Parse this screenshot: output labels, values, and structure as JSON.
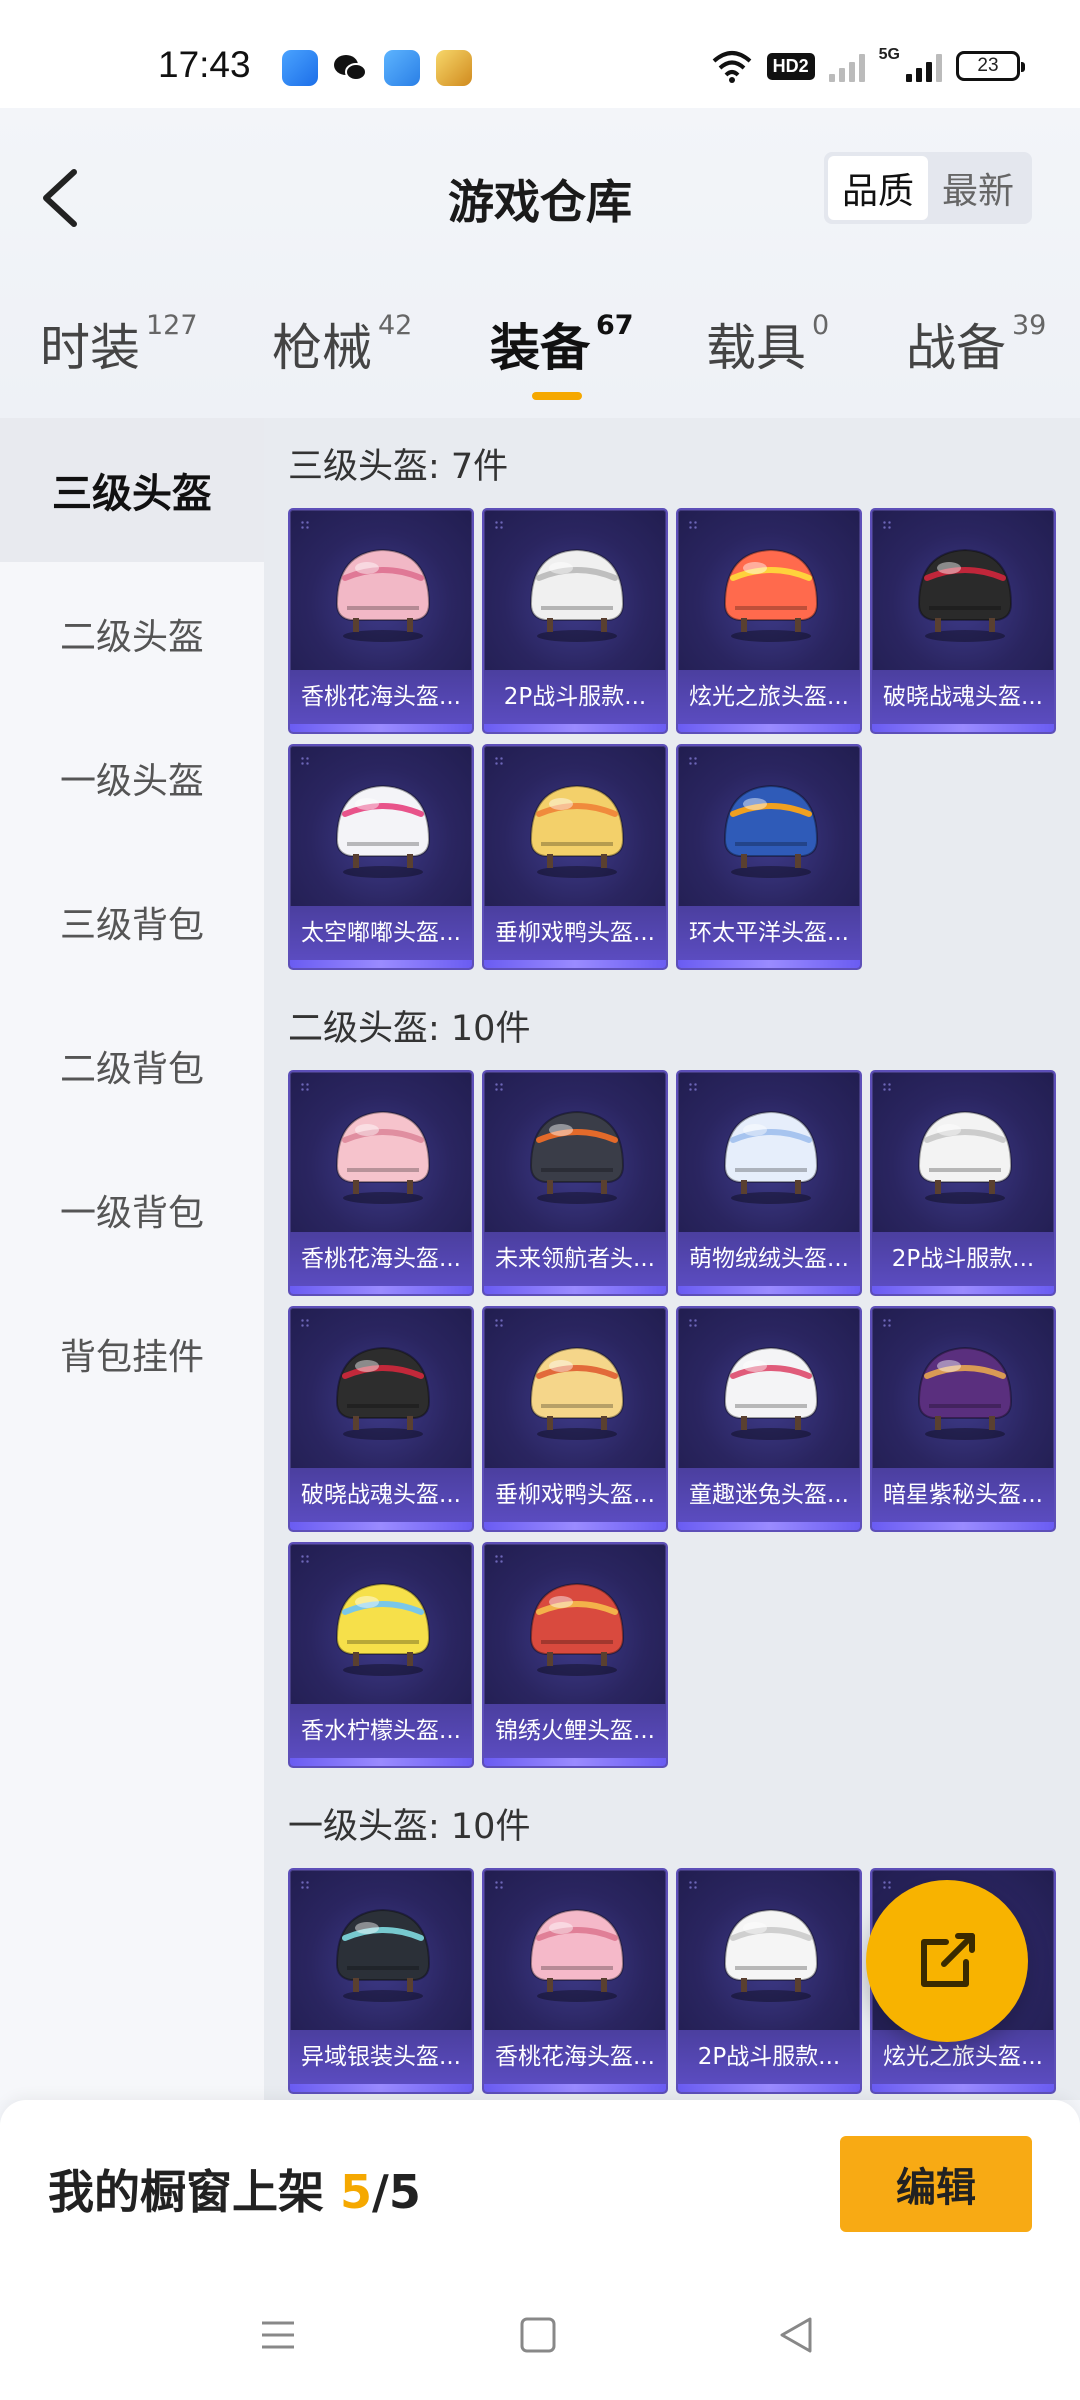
{
  "status_bar": {
    "time": "17:43",
    "network": "HD2",
    "network_type": "5G",
    "battery": "23",
    "icons": [
      "app-blue-icon",
      "wechat-icon",
      "app-cube-icon",
      "game-app-icon",
      "wifi-icon"
    ]
  },
  "header": {
    "title": "游戏仓库",
    "sort_options": [
      "品质",
      "最新"
    ],
    "active_sort": "品质"
  },
  "tabs": [
    {
      "label": "时装",
      "count": "127"
    },
    {
      "label": "枪械",
      "count": "42"
    },
    {
      "label": "装备",
      "count": "67"
    },
    {
      "label": "载具",
      "count": "0"
    },
    {
      "label": "战备",
      "count": "39"
    }
  ],
  "active_tab": "装备",
  "sidebar": {
    "items": [
      "三级头盔",
      "二级头盔",
      "一级头盔",
      "三级背包",
      "二级背包",
      "一级背包",
      "背包挂件"
    ],
    "active": "三级头盔"
  },
  "sections": [
    {
      "title": "三级头盔: 7件",
      "items": [
        {
          "name": "香桃花海头盔...",
          "color": "#f2b8c6",
          "accent": "#e07896"
        },
        {
          "name": "2P战斗服款...",
          "color": "#f0f0f0",
          "accent": "#bfbfbf"
        },
        {
          "name": "炫光之旅头盔...",
          "color": "#ff6a4d",
          "accent": "#ffd23c"
        },
        {
          "name": "破晓战魂头盔...",
          "color": "#2a2a2a",
          "accent": "#c0263a"
        },
        {
          "name": "太空嘟嘟头盔...",
          "color": "#f4f4f8",
          "accent": "#e8538a"
        },
        {
          "name": "垂柳戏鸭头盔...",
          "color": "#f3d06a",
          "accent": "#f08a3c"
        },
        {
          "name": "环太平洋头盔...",
          "color": "#2f5bb8",
          "accent": "#f0a020"
        }
      ]
    },
    {
      "title": "二级头盔: 10件",
      "items": [
        {
          "name": "香桃花海头盔...",
          "color": "#f6c3cc",
          "accent": "#e08ea0"
        },
        {
          "name": "未来领航者头...",
          "color": "#3a3d48",
          "accent": "#e36a2a"
        },
        {
          "name": "萌物绒绒头盔...",
          "color": "#e6eefb",
          "accent": "#a7c4ef"
        },
        {
          "name": "2P战斗服款...",
          "color": "#f3f3f3",
          "accent": "#cccccc"
        },
        {
          "name": "破晓战魂头盔...",
          "color": "#2d2d2d",
          "accent": "#c2283a"
        },
        {
          "name": "垂柳戏鸭头盔...",
          "color": "#f5d68a",
          "accent": "#e26a3a"
        },
        {
          "name": "童趣迷兔头盔...",
          "color": "#f4f4f6",
          "accent": "#e05b7a"
        },
        {
          "name": "暗星紫秘头盔...",
          "color": "#5a2f7e",
          "accent": "#d99a54"
        },
        {
          "name": "香水柠檬头盔...",
          "color": "#f6e04a",
          "accent": "#7ac7e8"
        },
        {
          "name": "锦绣火鲤头盔...",
          "color": "#d94a3e",
          "accent": "#f3b24a"
        }
      ]
    },
    {
      "title": "一级头盔: 10件",
      "items": [
        {
          "name": "异域银装头盔...",
          "color": "#2b3038",
          "accent": "#77c9cf"
        },
        {
          "name": "香桃花海头盔...",
          "color": "#f5b9c9",
          "accent": "#e07f97"
        },
        {
          "name": "2P战斗服款...",
          "color": "#f5f5f5",
          "accent": "#cfcfcf"
        },
        {
          "name": "炫光之旅头盔...",
          "color": "#ff7a52",
          "accent": "#ffd23c"
        }
      ]
    }
  ],
  "bottom_bar": {
    "showcase_label": "我的橱窗上架",
    "showcase_current": "5",
    "showcase_total": "5",
    "edit_label": "编辑"
  },
  "colors": {
    "accent": "#f5a800",
    "card_bg": "#2a2560",
    "card_label": "#5b4cc0"
  }
}
